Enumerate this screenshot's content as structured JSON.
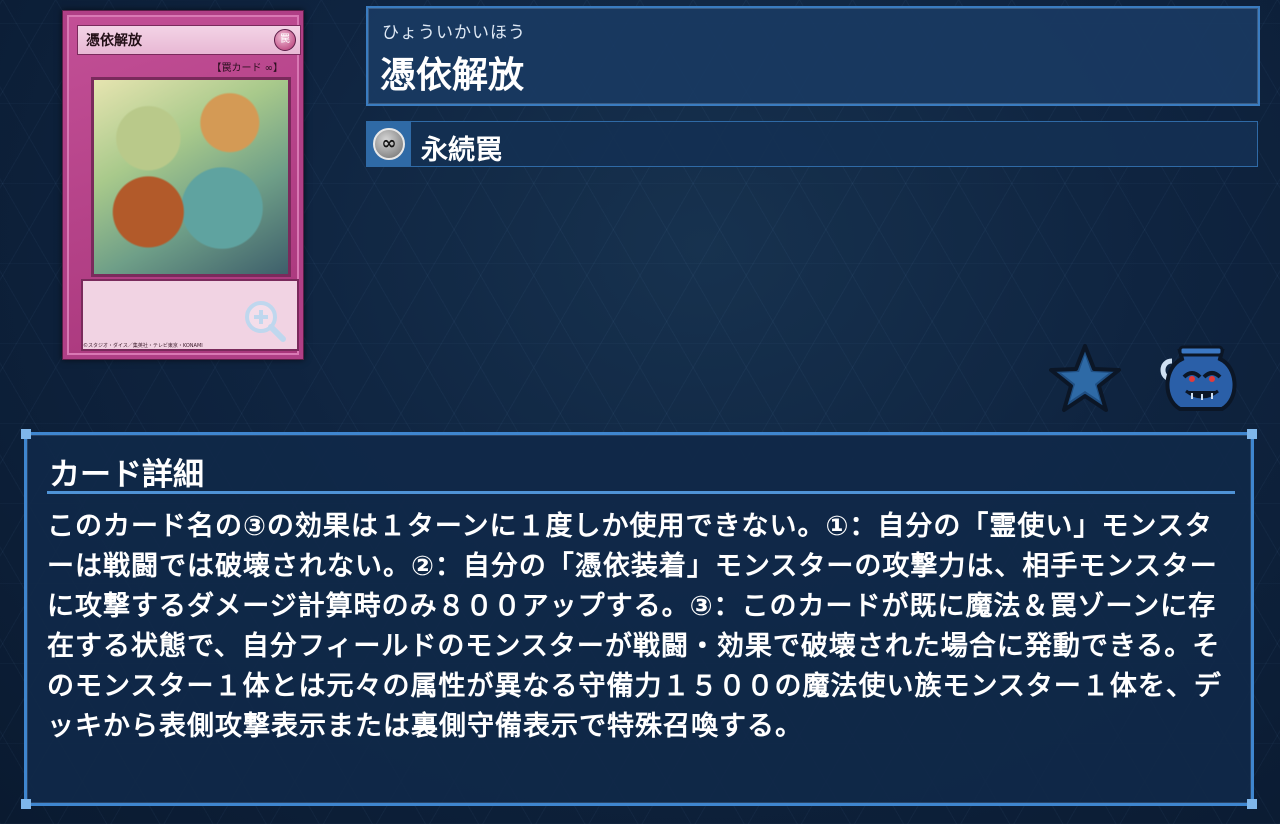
{
  "card_image": {
    "name": "憑依解放",
    "attribute_glyph": "罠",
    "type_line": "【罠カード ∞】",
    "copyright": "©スタジオ・ダイス／集英社・テレビ東京・KONAMI"
  },
  "name_box": {
    "ruby": "ひょういかいほう",
    "title": "憑依解放"
  },
  "type_box": {
    "icon": "continuous-infinity-icon",
    "icon_glyph": "∞",
    "label": "永続罠"
  },
  "actions": {
    "favorite_icon": "star-icon",
    "pot_icon": "pot-of-greed-icon"
  },
  "detail": {
    "heading": "カード詳細",
    "text": "このカード名の③の効果は１ターンに１度しか使用できない。①：自分の「霊使い」モンスターは戦闘では破壊されない。②：自分の「憑依装着」モンスターの攻撃力は、相手モンスターに攻撃するダメージ計算時のみ８００アップする。③：このカードが既に魔法＆罠ゾーンに存在する状態で、自分フィールドのモンスターが戦闘・効果で破壊された場合に発動できる。そのモンスター１体とは元々の属性が異なる守備力１５００の魔法使い族モンスター１体を、デッキから表側攻撃表示または裏側守備表示で特殊召喚する。"
  },
  "colors": {
    "background": "#0f2440",
    "panel_border": "#3f86cf",
    "card_frame": "#b03f86"
  }
}
